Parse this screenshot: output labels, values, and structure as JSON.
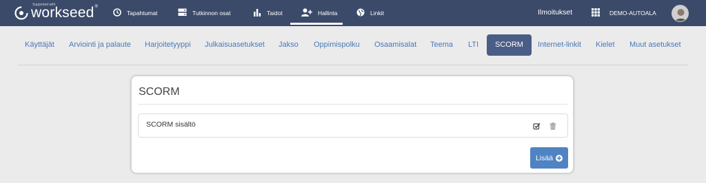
{
  "brand": {
    "tagline": "Supported with",
    "name": "workseed",
    "reg": "®"
  },
  "nav": {
    "items": [
      {
        "label": "Tapahtumat",
        "icon": "clock-icon"
      },
      {
        "label": "Tutkinnon osat",
        "icon": "server-icon"
      },
      {
        "label": "Taidot",
        "icon": "bar-chart-icon"
      },
      {
        "label": "Hallinta",
        "icon": "add-user-icon",
        "active": true
      },
      {
        "label": "Linkit",
        "icon": "globe-icon"
      }
    ],
    "notifications": "Ilmoitukset",
    "org": "DEMO-AUTOALA",
    "org_icon": "grid-icon"
  },
  "tabs": [
    {
      "label": "Käyttäjät"
    },
    {
      "label": "Arviointi ja palaute"
    },
    {
      "label": "Harjoitetyyppi"
    },
    {
      "label": "Julkaisuasetukset"
    },
    {
      "label": "Jakso"
    },
    {
      "label": "Oppimispolku"
    },
    {
      "label": "Osaamisalat"
    },
    {
      "label": "Teema"
    },
    {
      "label": "LTI"
    },
    {
      "label": "SCORM",
      "active": true
    },
    {
      "label": "Internet-linkit"
    },
    {
      "label": "Kielet"
    },
    {
      "label": "Muut asetukset"
    }
  ],
  "panel": {
    "title": "SCORM",
    "rows": [
      {
        "label": "SCORM sisältö",
        "edit_icon": "edit-icon",
        "delete_icon": "trash-icon"
      }
    ],
    "add_label": "Lisää",
    "add_icon": "plus-circle-icon"
  },
  "colors": {
    "navbar": "#3b4a69",
    "tab_link": "#4a79b5",
    "tab_active_bg": "#4a5d86",
    "button": "#4f83c3",
    "background": "#ebebeb"
  }
}
